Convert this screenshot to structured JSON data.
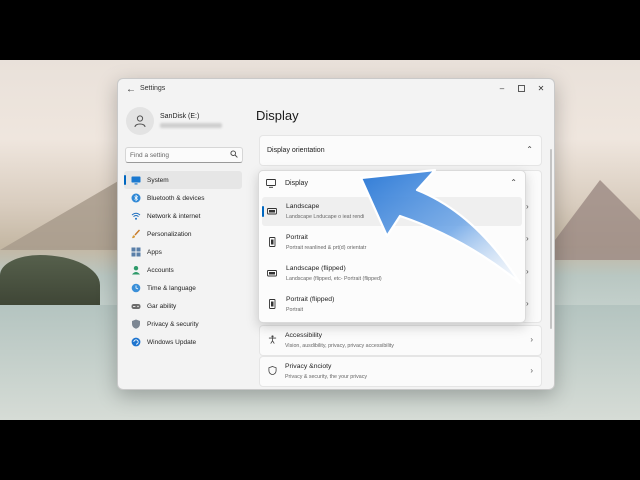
{
  "window": {
    "title": "Settings"
  },
  "profile": {
    "name": "SanDisk (E:)"
  },
  "search": {
    "placeholder": "Find a setting"
  },
  "sidebar": {
    "items": [
      {
        "label": "System",
        "icon": "monitor-icon",
        "active": true
      },
      {
        "label": "Bluetooth & devices",
        "icon": "bluetooth-icon"
      },
      {
        "label": "Network & internet",
        "icon": "wifi-icon"
      },
      {
        "label": "Personalization",
        "icon": "brush-icon"
      },
      {
        "label": "Apps",
        "icon": "apps-icon"
      },
      {
        "label": "Accounts",
        "icon": "person-icon"
      },
      {
        "label": "Time & language",
        "icon": "globe-clock-icon"
      },
      {
        "label": "Gar ability",
        "icon": "gamepad-icon"
      },
      {
        "label": "Privacy & security",
        "icon": "shield-icon"
      },
      {
        "label": "Windows Update",
        "icon": "update-icon"
      }
    ]
  },
  "main": {
    "title": "Display",
    "orientation_section": {
      "label": "Display orientation"
    },
    "dropdown": {
      "header": "Display",
      "options": [
        {
          "title": "Landscape",
          "subtitle": "Landscape  Lnducape o ieat rendi",
          "selected": true
        },
        {
          "title": "Portrait",
          "subtitle": "Portrait reanlined & prt(d) orientatr"
        },
        {
          "title": "Landscape (flipped)",
          "subtitle": "Landscape (flipped, etc- Portrait (flipped)"
        },
        {
          "title": "Portrait (flipped)",
          "subtitle": "Portrait"
        }
      ]
    },
    "rows": [
      {
        "title": "Accessibility",
        "subtitle": "Vision, ausdibility, privacy, privacy accessibility",
        "icon": "accessibility-icon"
      },
      {
        "title": "Privacy &ncioty",
        "subtitle": "Privacy & security, the your privacy",
        "icon": "shield-icon"
      }
    ]
  },
  "colors": {
    "accent": "#0067c0",
    "arrow": "#3b7fd4"
  }
}
